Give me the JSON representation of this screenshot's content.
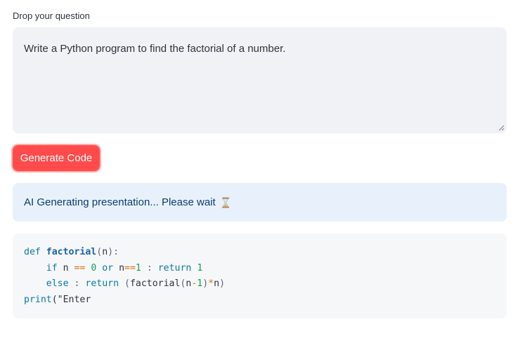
{
  "question": {
    "label": "Drop your question",
    "value": "Write a Python program to find the factorial of a number."
  },
  "actions": {
    "generate_label": "Generate Code"
  },
  "status": {
    "message": "AI Generating presentation... Please wait",
    "icon": "hourglass-icon"
  },
  "code": {
    "lines": [
      "def factorial(n):",
      "    if n == 0 or n==1 : return 1",
      "    else : return (factorial(n-1)*n)",
      "print(\"Enter"
    ]
  },
  "colors": {
    "accent": "#ff4b4b",
    "info_bg": "#e8f1fb",
    "input_bg": "#f0f2f6",
    "code_bg": "#f6f7f9"
  }
}
